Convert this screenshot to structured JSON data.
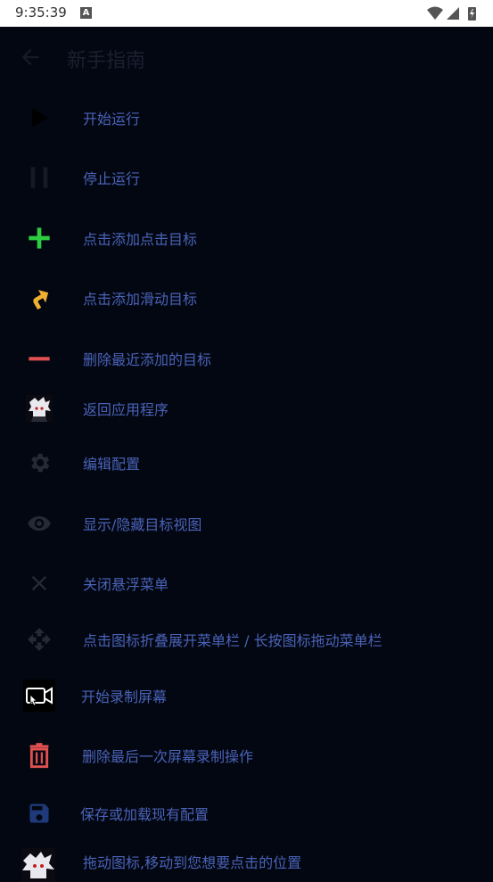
{
  "status_bar": {
    "time": "9:35:39",
    "notification_letter": "A"
  },
  "app_bar": {
    "title": "新手指南"
  },
  "items": [
    {
      "label": "开始运行",
      "icon": "play-icon",
      "color": "#000000"
    },
    {
      "label": "停止运行",
      "icon": "pause-icon",
      "color": "#151a25"
    },
    {
      "label": "点击添加点击目标",
      "icon": "plus-icon",
      "color": "#2ecc40"
    },
    {
      "label": "点击添加滑动目标",
      "icon": "swipe-arrow-icon",
      "color": "#f0b030"
    },
    {
      "label": "删除最近添加的目标",
      "icon": "minus-icon",
      "color": "#e05050"
    },
    {
      "label": "返回应用程序",
      "icon": "app-avatar-icon",
      "color": "#ffffff"
    },
    {
      "label": "编辑配置",
      "icon": "gear-icon",
      "color": "#252a35"
    },
    {
      "label": "显示/隐藏目标视图",
      "icon": "eye-icon",
      "color": "#252a35"
    },
    {
      "label": "关闭悬浮菜单",
      "icon": "close-icon",
      "color": "#252a35"
    },
    {
      "label": "点击图标折叠展开菜单栏 / 长按图标拖动菜单栏",
      "icon": "move-icon",
      "color": "#252a35"
    },
    {
      "label": "开始录制屏幕",
      "icon": "screen-record-icon",
      "color": "#ffffff"
    },
    {
      "label": "删除最后一次屏幕录制操作",
      "icon": "trash-icon",
      "color": "#e05050"
    },
    {
      "label": "保存或加载现有配置",
      "icon": "save-icon",
      "color": "#1e3a7a"
    },
    {
      "label": "拖动图标,移动到您想要点击的位置",
      "icon": "drag-avatar-icon",
      "color": "#ffffff"
    }
  ]
}
